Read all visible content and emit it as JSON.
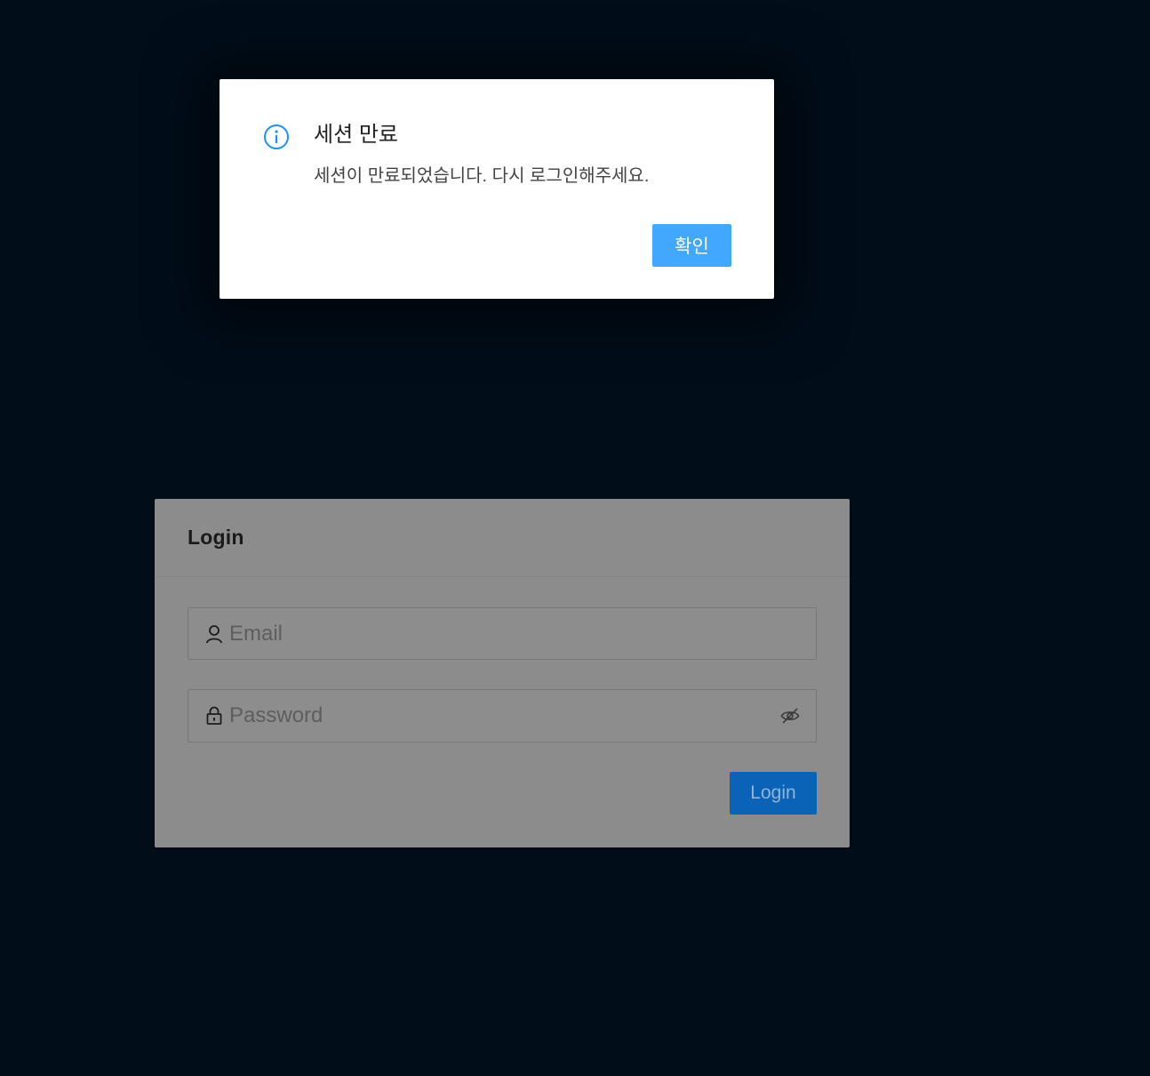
{
  "login": {
    "title": "Login",
    "email_placeholder": "Email",
    "password_placeholder": "Password",
    "submit_label": "Login",
    "icons": {
      "email": "user-icon",
      "password": "lock-icon",
      "toggle_visibility": "eye-invisible-icon"
    }
  },
  "modal": {
    "icon": "info-circle-icon",
    "title": "세션 만료",
    "content": "세션이 만료되었습니다. 다시 로그인해주세요.",
    "ok_label": "확인"
  },
  "colors": {
    "background": "#010d19",
    "modal_icon": "#1890ff",
    "ok_button": "#40a9ff",
    "login_button": "#0b63b8"
  }
}
